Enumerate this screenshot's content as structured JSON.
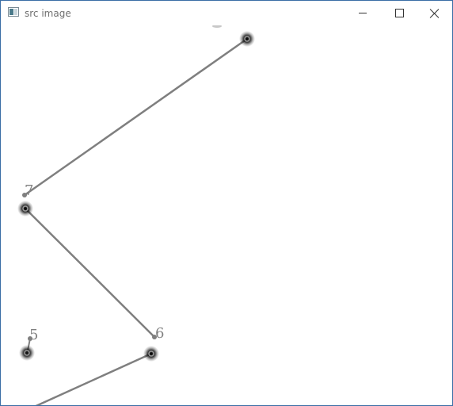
{
  "window": {
    "title": "src image",
    "buttons": {
      "minimize_icon": "minimize-icon",
      "maximize_icon": "maximize-icon",
      "close_icon": "close-icon"
    }
  },
  "canvas": {
    "line_color": "#7f7f7f",
    "glow_color": "#000000",
    "labels": {
      "point_7": "7",
      "point_6": "6",
      "point_5": "5"
    }
  }
}
